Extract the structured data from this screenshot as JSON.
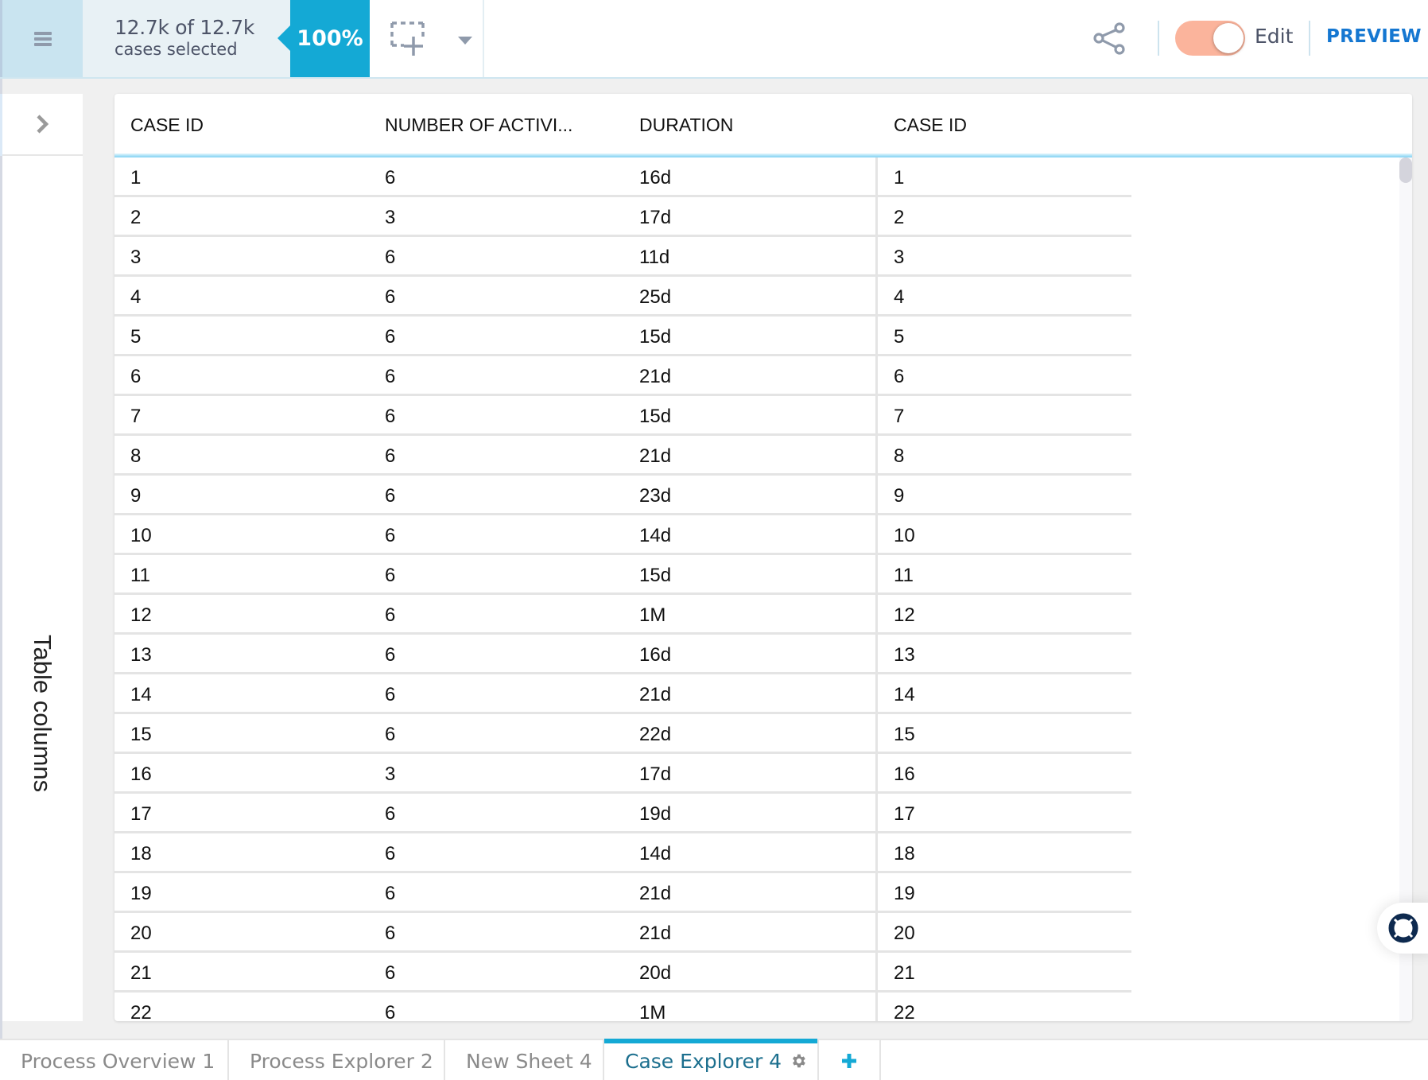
{
  "header": {
    "menu_icon": "hamburger-menu-icon",
    "selection_count": "12.7k of 12.7k",
    "selection_caption": "cases selected",
    "selection_percent": "100%",
    "select_tool_icon": "dashed-selection-add-icon",
    "dropdown_icon": "caret-down-icon",
    "share_icon": "share-icon",
    "edit_toggle_on": true,
    "edit_label": "Edit",
    "preview_label": "PREVIEW"
  },
  "side_panel": {
    "expand_icon": "chevron-right-icon",
    "label": "Table columns"
  },
  "table": {
    "columns": [
      "CASE ID",
      "NUMBER OF ACTIVI...",
      "DURATION",
      "CASE ID"
    ],
    "rows": [
      [
        "1",
        "6",
        "16d",
        "1"
      ],
      [
        "2",
        "3",
        "17d",
        "2"
      ],
      [
        "3",
        "6",
        "11d",
        "3"
      ],
      [
        "4",
        "6",
        "25d",
        "4"
      ],
      [
        "5",
        "6",
        "15d",
        "5"
      ],
      [
        "6",
        "6",
        "21d",
        "6"
      ],
      [
        "7",
        "6",
        "15d",
        "7"
      ],
      [
        "8",
        "6",
        "21d",
        "8"
      ],
      [
        "9",
        "6",
        "23d",
        "9"
      ],
      [
        "10",
        "6",
        "14d",
        "10"
      ],
      [
        "11",
        "6",
        "15d",
        "11"
      ],
      [
        "12",
        "6",
        "1M",
        "12"
      ],
      [
        "13",
        "6",
        "16d",
        "13"
      ],
      [
        "14",
        "6",
        "21d",
        "14"
      ],
      [
        "15",
        "6",
        "22d",
        "15"
      ],
      [
        "16",
        "3",
        "17d",
        "16"
      ],
      [
        "17",
        "6",
        "19d",
        "17"
      ],
      [
        "18",
        "6",
        "14d",
        "18"
      ],
      [
        "19",
        "6",
        "21d",
        "19"
      ],
      [
        "20",
        "6",
        "21d",
        "20"
      ],
      [
        "21",
        "6",
        "20d",
        "21"
      ],
      [
        "22",
        "6",
        "1M",
        "22"
      ]
    ]
  },
  "help_icon": "lifebuoy-icon",
  "tabs": [
    {
      "label": "Process Overview 1",
      "active": false
    },
    {
      "label": "Process Explorer 2",
      "active": false
    },
    {
      "label": "New Sheet 4",
      "active": false
    },
    {
      "label": "Case Explorer 4",
      "active": true,
      "icon": "gear-icon"
    }
  ],
  "add_tab_icon": "plus-icon",
  "colors": {
    "accent": "#14a9d5",
    "preview": "#1577d1",
    "toggle_on": "#fbb49c",
    "help_icon": "#0e2a4f"
  }
}
